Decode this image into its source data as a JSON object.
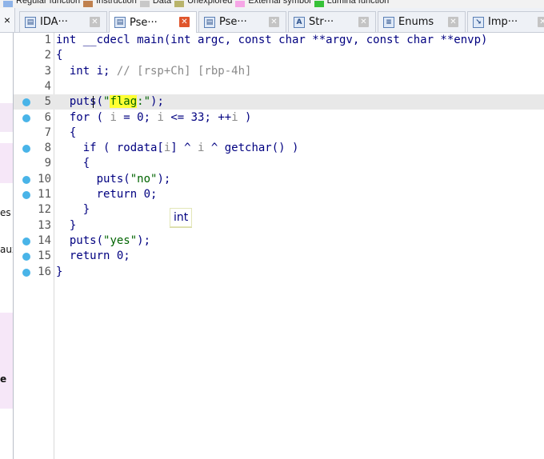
{
  "legend": [
    {
      "label": "Regular function",
      "color": "#8fb4e8"
    },
    {
      "label": "Instruction",
      "color": "#c0814e"
    },
    {
      "label": "Data",
      "color": "#c8c8c8"
    },
    {
      "label": "Unexplored",
      "color": "#b9b46b"
    },
    {
      "label": "External symbol",
      "color": "#f6a6e6"
    },
    {
      "label": "Lumina function",
      "color": "#37c237"
    }
  ],
  "close_left": "×",
  "tabs": [
    {
      "label": "IDA···",
      "icon": "ida-view-icon",
      "active": false
    },
    {
      "label": "Pse···",
      "icon": "pseudocode-icon",
      "active": true
    },
    {
      "label": "Pse···",
      "icon": "pseudocode-icon",
      "active": false
    },
    {
      "label": "Str···",
      "icon": "strings-icon",
      "active": false
    },
    {
      "label": "Enums",
      "icon": "enums-icon",
      "active": false
    },
    {
      "label": "Imp···",
      "icon": "imports-icon",
      "active": false
    }
  ],
  "left_panel": {
    "fragments": [
      "es",
      "aux",
      "e"
    ]
  },
  "code": {
    "lines": [
      {
        "n": "1",
        "bp": false,
        "seg": [
          {
            "t": "int __cdecl main(int argc, const char **argv, const char **envp)",
            "c": "k"
          }
        ]
      },
      {
        "n": "2",
        "bp": false,
        "seg": [
          {
            "t": "{",
            "c": "k"
          }
        ]
      },
      {
        "n": "3",
        "bp": false,
        "seg": [
          {
            "t": "  int i; ",
            "c": "k"
          },
          {
            "t": "// [rsp+Ch] [rbp-4h]",
            "c": "cmt"
          }
        ]
      },
      {
        "n": "4",
        "bp": false,
        "seg": []
      },
      {
        "n": "5",
        "bp": true,
        "seg": [
          {
            "t": "  puts(",
            "c": "k"
          },
          {
            "t": "\"",
            "c": "str"
          },
          {
            "t": "flag",
            "c": "strhl"
          },
          {
            "t": ":\"",
            "c": "str"
          },
          {
            "t": ");",
            "c": "k"
          }
        ]
      },
      {
        "n": "6",
        "bp": true,
        "seg": [
          {
            "t": "  for ( ",
            "c": "k"
          },
          {
            "t": "i",
            "c": "var"
          },
          {
            "t": " = 0; ",
            "c": "k"
          },
          {
            "t": "i",
            "c": "var"
          },
          {
            "t": " <= 33; ++",
            "c": "k"
          },
          {
            "t": "i",
            "c": "var"
          },
          {
            "t": " )",
            "c": "k"
          }
        ]
      },
      {
        "n": "7",
        "bp": false,
        "seg": [
          {
            "t": "  {",
            "c": "k"
          }
        ]
      },
      {
        "n": "8",
        "bp": true,
        "seg": [
          {
            "t": "    if ( rodata[",
            "c": "k"
          },
          {
            "t": "i",
            "c": "var"
          },
          {
            "t": "] ^ ",
            "c": "k"
          },
          {
            "t": "i",
            "c": "var"
          },
          {
            "t": " ^ getchar() )",
            "c": "k"
          }
        ]
      },
      {
        "n": "9",
        "bp": false,
        "seg": [
          {
            "t": "    {",
            "c": "k"
          }
        ]
      },
      {
        "n": "10",
        "bp": true,
        "seg": [
          {
            "t": "      puts(",
            "c": "k"
          },
          {
            "t": "\"no\"",
            "c": "str"
          },
          {
            "t": ");",
            "c": "k"
          }
        ]
      },
      {
        "n": "11",
        "bp": true,
        "seg": [
          {
            "t": "      return 0;",
            "c": "k"
          }
        ]
      },
      {
        "n": "12",
        "bp": false,
        "seg": [
          {
            "t": "    }",
            "c": "k"
          }
        ]
      },
      {
        "n": "13",
        "bp": false,
        "seg": [
          {
            "t": "  }",
            "c": "k"
          }
        ]
      },
      {
        "n": "14",
        "bp": true,
        "seg": [
          {
            "t": "  puts(",
            "c": "k"
          },
          {
            "t": "\"yes\"",
            "c": "str"
          },
          {
            "t": ");",
            "c": "k"
          }
        ]
      },
      {
        "n": "15",
        "bp": true,
        "seg": [
          {
            "t": "  return 0;",
            "c": "k"
          }
        ]
      },
      {
        "n": "16",
        "bp": true,
        "seg": [
          {
            "t": "}",
            "c": "k"
          }
        ]
      }
    ],
    "current_line": "5"
  },
  "tooltip": "int"
}
